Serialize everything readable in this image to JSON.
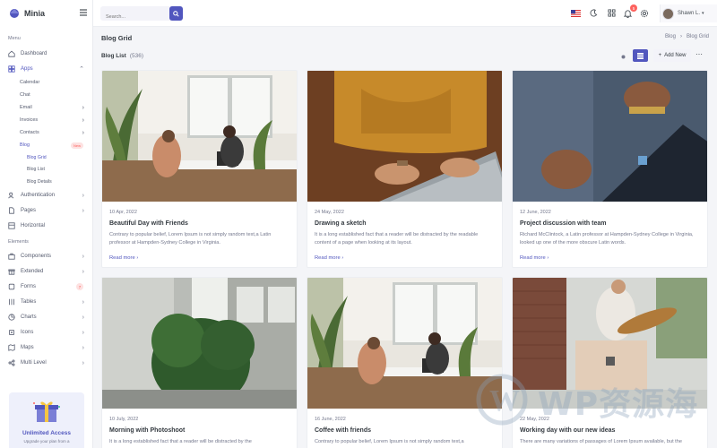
{
  "brand": {
    "name": "Minia"
  },
  "sidebar": {
    "menu_title": "Menu",
    "elements_title": "Elements",
    "items": [
      {
        "label": "Dashboard"
      },
      {
        "label": "Apps"
      },
      {
        "label": "Calendar"
      },
      {
        "label": "Chat"
      },
      {
        "label": "Email"
      },
      {
        "label": "Invoices"
      },
      {
        "label": "Contacts"
      },
      {
        "label": "Blog",
        "badge": "New"
      },
      {
        "label": "Blog Grid"
      },
      {
        "label": "Blog List"
      },
      {
        "label": "Blog Details"
      },
      {
        "label": "Authentication"
      },
      {
        "label": "Pages"
      },
      {
        "label": "Horizontal"
      },
      {
        "label": "Components"
      },
      {
        "label": "Extended"
      },
      {
        "label": "Forms",
        "badge": "7"
      },
      {
        "label": "Tables"
      },
      {
        "label": "Charts"
      },
      {
        "label": "Icons"
      },
      {
        "label": "Maps"
      },
      {
        "label": "Multi Level"
      }
    ],
    "promo": {
      "title": "Unlimited Access",
      "subtitle": "Upgrade your plan from a"
    }
  },
  "topbar": {
    "search_placeholder": "Search...",
    "notification_count": "5",
    "user_name": "Shawn L."
  },
  "page": {
    "title": "Blog Grid",
    "breadcrumb": [
      "Blog",
      "Blog Grid"
    ],
    "list_title": "Blog List",
    "list_count": "(536)",
    "add_button": "Add New"
  },
  "posts": [
    {
      "date": "10 Apr, 2022",
      "title": "Beautiful Day with Friends",
      "text": "Contrary to popular belief, Lorem Ipsum is not simply random text,a Latin professor at Hampden-Sydney College in Virginia.",
      "link": "Read more"
    },
    {
      "date": "24 May, 2022",
      "title": "Drawing a sketch",
      "text": "It is a long established fact that a reader will be distracted by the readable content of a page when looking at its layout.",
      "link": "Read more"
    },
    {
      "date": "12 June, 2022",
      "title": "Project discussion with team",
      "text": "Richard McClintock, a Latin professor at Hampden-Sydney College in Virginia, looked up one of the more obscure Latin words.",
      "link": "Read more"
    },
    {
      "date": "10 July, 2022",
      "title": "Morning with Photoshoot",
      "text": "It is a long established fact that a reader will be distracted by the",
      "link": ""
    },
    {
      "date": "16 June, 2022",
      "title": "Coffee with friends",
      "text": "Contrary to popular belief, Lorem Ipsum is not simply random text,a",
      "link": ""
    },
    {
      "date": "22 May, 2022",
      "title": "Working day with our new ideas",
      "text": "There are many variations of passages of Lorem Ipsum available, but the",
      "link": ""
    }
  ],
  "watermark": {
    "text": "WP资源海"
  },
  "colors": {
    "accent": "#5156be",
    "danger": "#fd625e"
  }
}
